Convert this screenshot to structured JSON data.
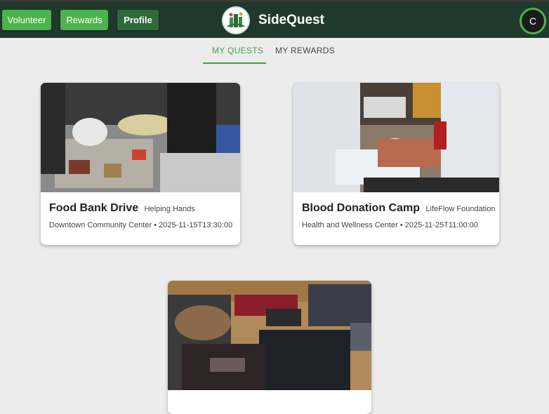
{
  "header": {
    "buttons": {
      "volunteer": "Volunteer",
      "rewards": "Rewards",
      "profile": "Profile"
    },
    "brand_name": "SideQuest",
    "avatar_initial": "C",
    "colors": {
      "bar": "#1f3a2c",
      "accent": "#4db34d"
    }
  },
  "tabs": [
    {
      "label": "MY QUESTS",
      "active": true
    },
    {
      "label": "MY REWARDS",
      "active": false
    }
  ],
  "quests": [
    {
      "title": "Food Bank Drive",
      "organization": "Helping Hands",
      "location": "Downtown Community Center",
      "separator": "•",
      "datetime": "2025-11-15T13:30:00",
      "image": "food-bank-volunteers-photo"
    },
    {
      "title": "Blood Donation Camp",
      "organization": "LifeFlow Foundation",
      "location": "Health and Wellness Center",
      "separator": "•",
      "datetime": "2025-11-25T11:00:00",
      "image": "blood-donation-photo"
    },
    {
      "title": "",
      "organization": "",
      "location": "",
      "datetime": "",
      "image": "clothing-donation-photo"
    }
  ]
}
